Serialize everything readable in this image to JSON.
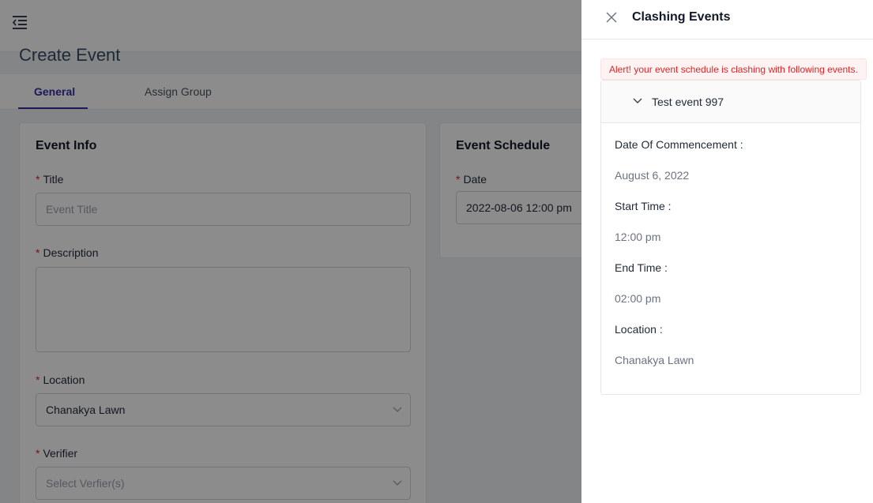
{
  "page": {
    "title": "Create Event",
    "tabs": [
      {
        "label": "General",
        "active": true
      },
      {
        "label": "Assign Group",
        "active": false
      }
    ]
  },
  "event_info": {
    "heading": "Event Info",
    "title_label": "Title",
    "title_placeholder": "Event Title",
    "description_label": "Description",
    "location_label": "Location",
    "location_value": "Chanakya Lawn",
    "verifier_label": "Verifier",
    "verifier_placeholder": "Select Verfier(s)"
  },
  "event_schedule": {
    "heading": "Event Schedule",
    "date_label": "Date",
    "date_value": "2022-08-06 12:00 pm"
  },
  "drawer": {
    "title": "Clashing Events",
    "alert": "Alert! your event schedule is clashing with following events.",
    "event": {
      "name": "Test event 997",
      "commencement_label": "Date Of Commencement",
      "commencement_value": "August 6, 2022",
      "start_label": "Start Time",
      "start_value": "12:00 pm",
      "end_label": "End Time",
      "end_value": "02:00 pm",
      "location_label": "Location",
      "location_value": "Chanakya Lawn"
    }
  },
  "colors": {
    "accent": "#3730a3",
    "required": "#dc2626",
    "alert_text": "#dc2626",
    "overlay": "rgba(0,0,0,0.45)"
  },
  "icons": {
    "menu": "menu-collapse-icon",
    "close": "close-icon",
    "chevron": "chevron-down-icon"
  }
}
